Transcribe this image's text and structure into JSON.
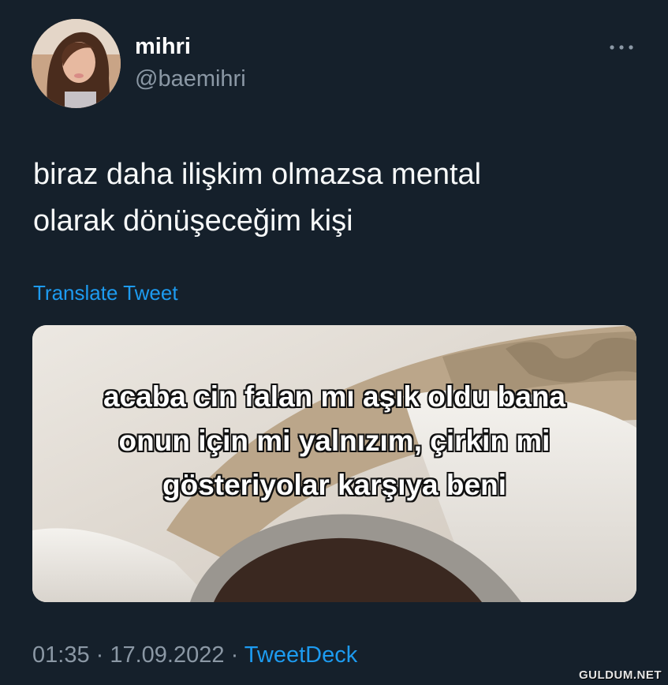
{
  "author": {
    "display_name": "mihri",
    "handle": "@baemihri"
  },
  "tweet": {
    "text_lines": [
      "biraz daha ilişkim olmazsa mental",
      "olarak dönüşeceğim kişi"
    ],
    "translate_label": "Translate Tweet"
  },
  "media": {
    "caption_lines": [
      "acaba cin falan mı aşık oldu bana",
      "onun için mi yalnızım, çirkin mi",
      "gösteriyolar karşıya beni"
    ]
  },
  "meta": {
    "time": "01:35",
    "separator_1": " · ",
    "date": "17.09.2022",
    "separator_2": " · ",
    "source": "TweetDeck"
  },
  "watermark": "GULDUM.NET",
  "icons": {
    "more": "more-horizontal-icon"
  },
  "colors": {
    "background": "#15202b",
    "text": "#f7f9f9",
    "secondary": "#8b98a5",
    "accent": "#1d9bf0"
  }
}
